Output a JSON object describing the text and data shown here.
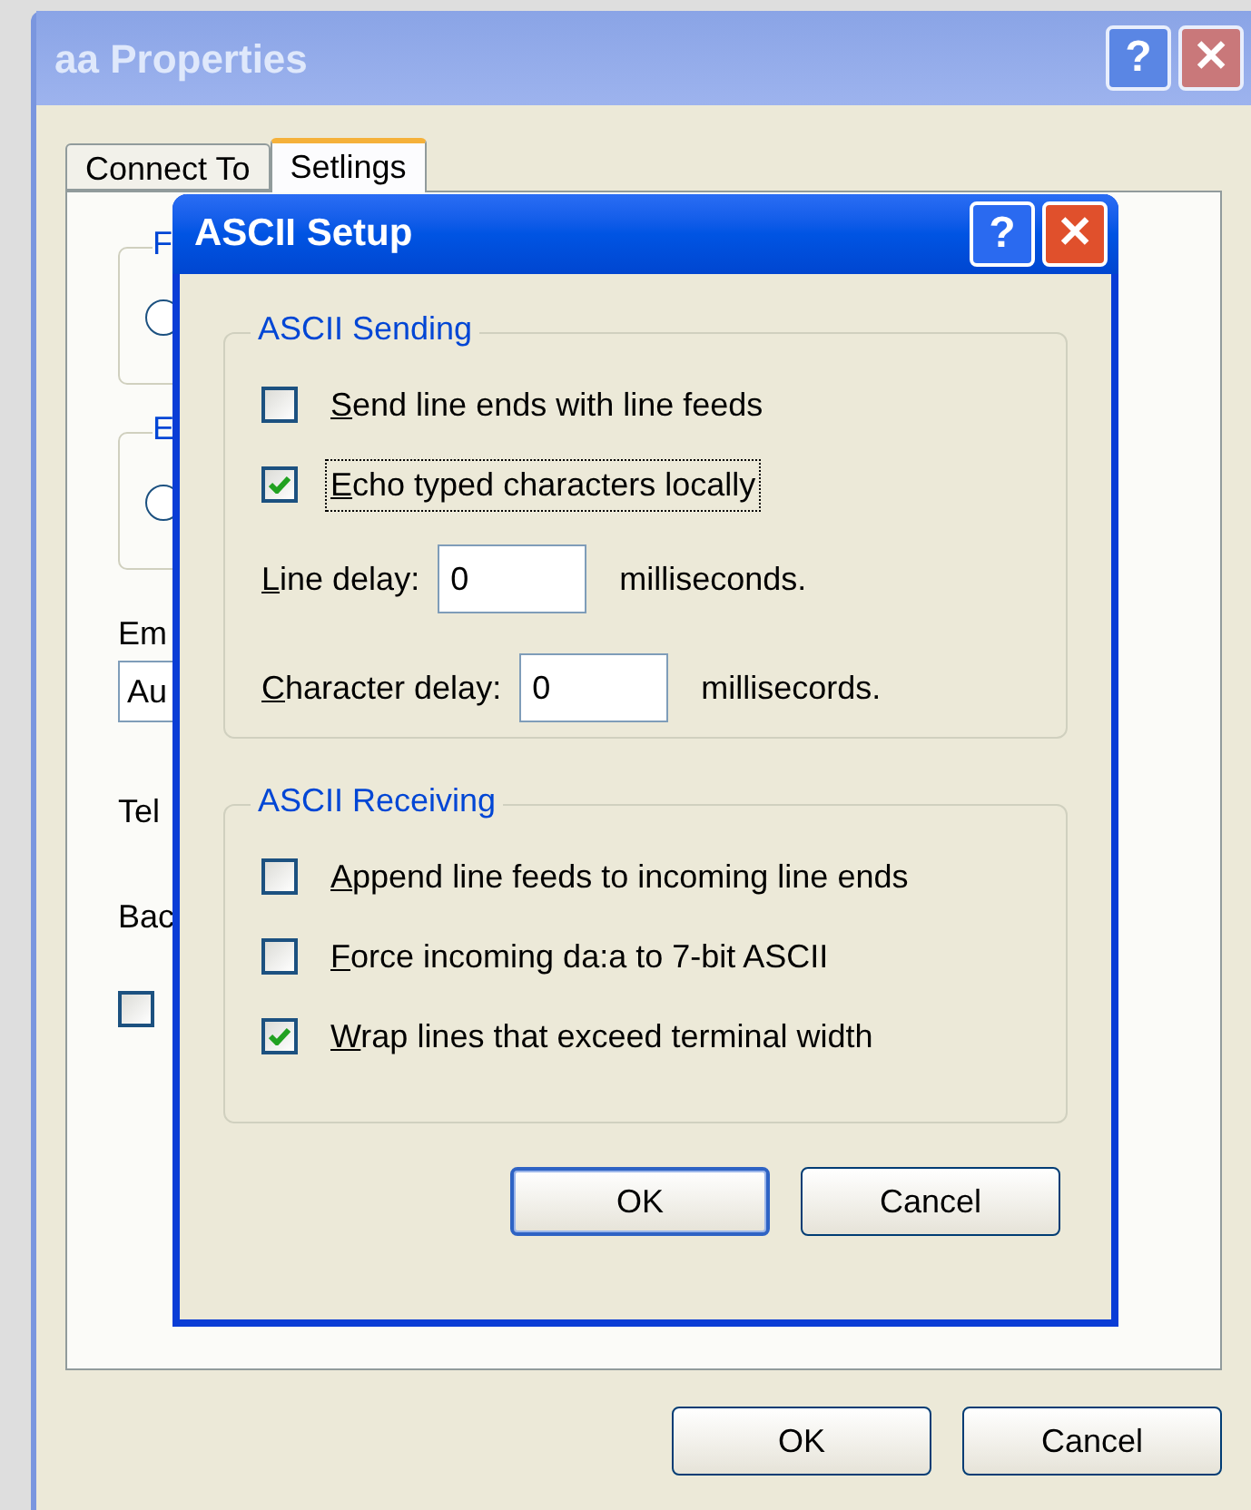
{
  "window": {
    "title": "aa Properties",
    "title_buttons": [
      {
        "kind": "help",
        "label": "?"
      },
      {
        "kind": "close",
        "label": "✕"
      }
    ]
  },
  "tabs": [
    {
      "label": "Connect To",
      "selected": false
    },
    {
      "label": "Setlings",
      "selected": true
    }
  ],
  "background_panel": {
    "groups": [
      {
        "title": "F",
        "selected": false
      },
      {
        "title": "E",
        "selected": false
      }
    ],
    "fields": [
      {
        "label": "Em",
        "value": "Au"
      }
    ],
    "labels": [
      "Tel",
      "Bac"
    ],
    "checkbox": {
      "checked": false
    }
  },
  "dialog": {
    "title": "ASCII Setup",
    "title_buttons": [
      {
        "kind": "help",
        "label": "?"
      },
      {
        "kind": "close",
        "label": "✕"
      }
    ],
    "groups": [
      {
        "title": "ASCII Sending",
        "items": [
          {
            "kind": "checkbox",
            "label": "Send line ends with line feeds",
            "checked": false,
            "focused": false
          },
          {
            "kind": "checkbox",
            "label": "Echo typed characters locally",
            "checked": true,
            "focused": true
          },
          {
            "kind": "number",
            "label": "Line delay:",
            "value": "0",
            "unit": "milliseconds."
          },
          {
            "kind": "number",
            "label": "Character delay:",
            "value": "0",
            "unit": "millisecords."
          }
        ]
      },
      {
        "title": "ASCII Receiving",
        "items": [
          {
            "kind": "checkbox",
            "label": "Append line feeds to incoming line ends",
            "checked": false,
            "focused": false
          },
          {
            "kind": "checkbox",
            "label": "Force incoming da:a to 7-bit ASCII",
            "checked": false,
            "focused": false
          },
          {
            "kind": "checkbox",
            "label": "Wrap lines that exceed terminal width",
            "checked": true,
            "focused": false
          }
        ]
      }
    ],
    "buttons": [
      {
        "label": "OK",
        "default": true
      },
      {
        "label": "Cancel",
        "default": false
      }
    ]
  },
  "buttons": [
    {
      "label": "OK",
      "default": false
    },
    {
      "label": "Cancel",
      "default": false
    }
  ]
}
